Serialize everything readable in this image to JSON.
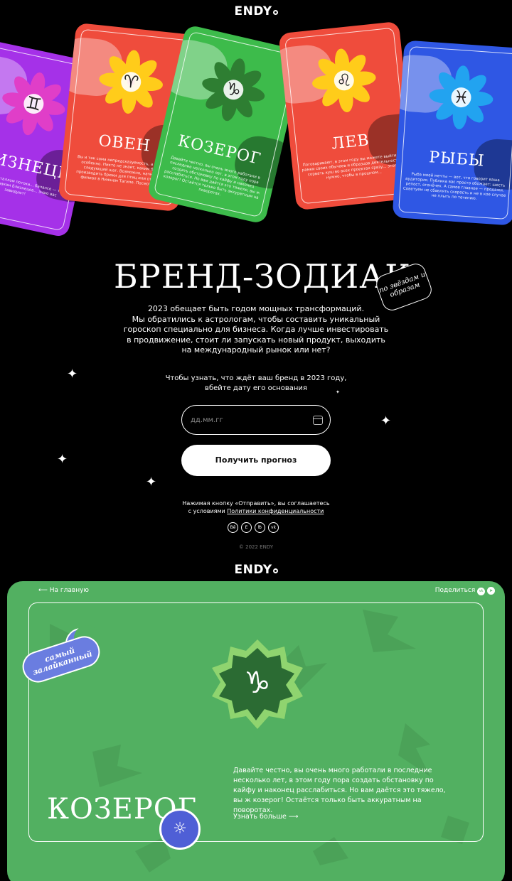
{
  "header": {
    "logo": "ENDY"
  },
  "cards": [
    {
      "title": "БЛИЗНЕЦЫ",
      "symbol": "♊",
      "color": "#a531e8",
      "petal": "#e03ec8",
      "text": "...курсе, а кристаллом потока... балансе — так говорит... знаком Близнецов... знаю вас завидуют!"
    },
    {
      "title": "ОВЕН",
      "symbol": "♈",
      "color": "#ef4c3c",
      "petal": "#ffcc1a",
      "text": "Вы и так сама непредсказуемость, а в 2023 особенно. Никто не знает, каким будет следующий шаг. Возможно, начнёте производить брюки для птиц или откроете филиал в Нижнем Тагиле. Посмотрим!"
    },
    {
      "title": "КОЗЕРОГ",
      "symbol": "♑",
      "color": "#3dbb4b",
      "petal": "#2e7e32",
      "text": "Давайте честно, вы очень много работали в последние несколько лет, в этом году пора создать обстановку по кайфу и наконец расслабиться. Но вам даётся это тяжело, вы ж козерог! Остаётся только быть аккуратным на поворотах."
    },
    {
      "title": "ЛЕВ",
      "symbol": "♌",
      "color": "#ef4c3c",
      "petal": "#ffcc1a",
      "text": "Поговаривают, в этом году вы можете выйти за рамки своих обычаев и образцов деятельности и сорвать куш во всех проектах сразу... этого нужно, чтобы в прошлом..."
    },
    {
      "title": "РЫБЫ",
      "symbol": "♓",
      "color": "#2f57e4",
      "petal": "#22a3f0",
      "text": "Рыба моей мечты — вот, что говорит ваша аудитория. Публика вас просто обожает: шесть репост, огонёчек. А самое главное — продажи. Советуем не сбавлять скорость и не в кое случае не плыть по течению."
    }
  ],
  "hero": {
    "title": "БРЕНД-ЗОДИАК",
    "sticker": "по звёздам и образам",
    "description": [
      "2023 обещает быть годом мощных трансформаций.",
      "Мы обратились к астрологам, чтобы составить уникальный",
      "гороскоп специально для бизнеса. Когда лучше инвестировать",
      "в продвижение, стоит ли запускать новый продукт, выходить",
      "на международный рынок или нет?"
    ],
    "ask": [
      "Чтобы узнать, что ждёт ваш бренд в 2023 году,",
      "вбейте дату его основания"
    ],
    "input_placeholder": "дд.мм.гг",
    "button": "Получить прогноз",
    "agree_line1": "Нажимая кнопку «Отправить», вы соглашаетесь",
    "agree_prefix": "с условиями ",
    "agree_link": "Политики конфиденциальности",
    "socials": [
      "Bē",
      "E",
      "℔",
      "vk"
    ],
    "copyright": "© 2022 ENDY"
  },
  "result": {
    "logo": "ENDY",
    "back": "На главную",
    "share": "Поделиться",
    "badge": "самый залайканный",
    "title": "КОЗЕРОГ",
    "symbol": "♑",
    "text": "Давайте честно, вы очень много работали в последние несколько лет, в этом году пора создать обстановку по кайфу и наконец расслабиться. Но вам даётся это тяжело, вы ж козерог! Остаётся только быть аккуратным на поворотах.",
    "more": "Узнать больше"
  }
}
